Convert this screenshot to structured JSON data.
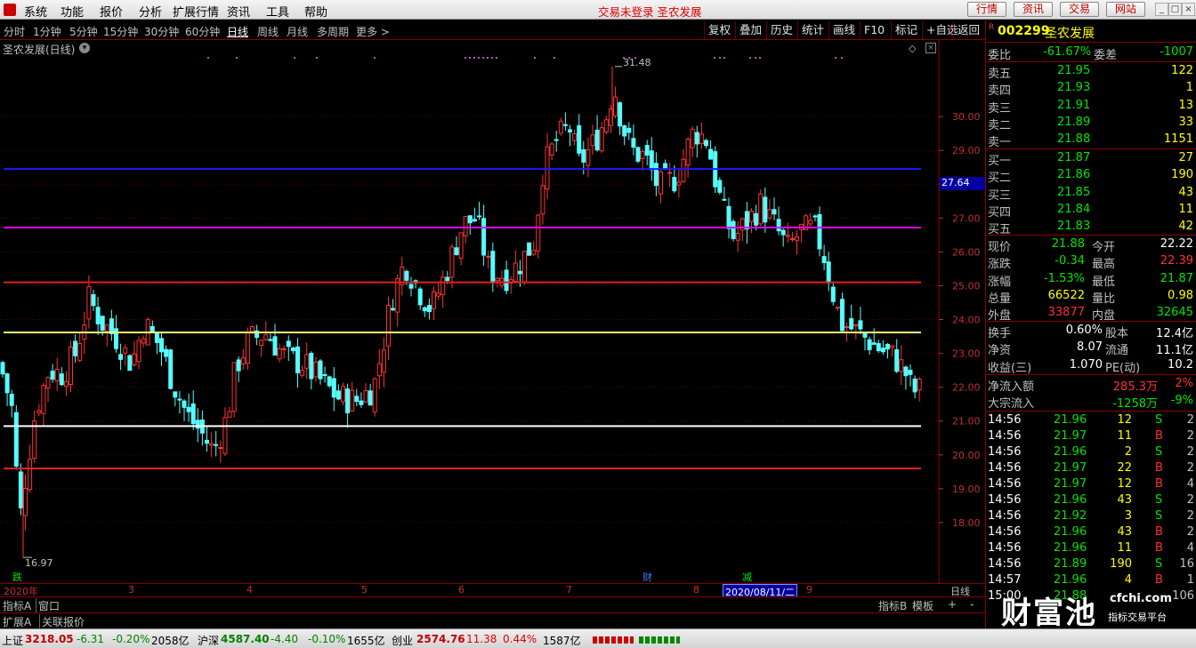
{
  "menu": {
    "items": [
      "系统",
      "功能",
      "报价",
      "分析",
      "扩展行情",
      "资讯",
      "工具",
      "帮助"
    ],
    "title": "交易未登录  圣农发展",
    "buttons": [
      "行情",
      "资讯",
      "交易",
      "网站"
    ]
  },
  "toolbar": {
    "periods": [
      "分时",
      "1分钟",
      "5分钟",
      "15分钟",
      "30分钟",
      "60分钟",
      "日线",
      "周线",
      "月线",
      "多周期",
      "更多 >"
    ],
    "active": "日线",
    "right": [
      "复权",
      "叠加",
      "历史",
      "统计",
      "画线",
      "F10",
      "标记",
      "+自选",
      "返回"
    ]
  },
  "chart": {
    "title": "圣农发展(日线)",
    "high_label": "31.48",
    "low_label": "16.97",
    "cursor_price": "27.64",
    "yticks": [
      "30.00",
      "29.00",
      "28.00",
      "27.00",
      "26.00",
      "25.00",
      "24.00",
      "23.00",
      "22.00",
      "21.00",
      "20.00",
      "19.00",
      "18.00"
    ],
    "markers": [
      "跌",
      "财",
      "减"
    ],
    "xlabels": [
      "2020年",
      "3",
      "4",
      "5",
      "6",
      "7",
      "8",
      "9"
    ],
    "date_tip": "2020/08/11/二",
    "period": "日线"
  },
  "chart_data": {
    "type": "candlestick",
    "symbol": "002299 圣农发展",
    "ylim": [
      16.5,
      32
    ],
    "high": 31.48,
    "low": 16.97,
    "hlines": [
      {
        "price": 28.45,
        "color": "#1a1aff"
      },
      {
        "price": 26.72,
        "color": "#e000e0"
      },
      {
        "price": 25.1,
        "color": "#e02020"
      },
      {
        "price": 23.62,
        "color": "#ffff80"
      },
      {
        "price": 20.85,
        "color": "#ffffff"
      },
      {
        "price": 19.6,
        "color": "#e02020"
      }
    ]
  },
  "quote": {
    "code": "002299",
    "name": "圣农发展",
    "webi_label": "委比",
    "webi": "-61.67%",
    "weicha_label": "委差",
    "weicha": "-1007",
    "sell": [
      {
        "label": "卖五",
        "price": "21.95",
        "vol": "122"
      },
      {
        "label": "卖四",
        "price": "21.93",
        "vol": "1"
      },
      {
        "label": "卖三",
        "price": "21.91",
        "vol": "13"
      },
      {
        "label": "卖二",
        "price": "21.89",
        "vol": "33"
      },
      {
        "label": "卖一",
        "price": "21.88",
        "vol": "1151"
      }
    ],
    "buy": [
      {
        "label": "买一",
        "price": "21.87",
        "vol": "27"
      },
      {
        "label": "买二",
        "price": "21.86",
        "vol": "190"
      },
      {
        "label": "买三",
        "price": "21.85",
        "vol": "43"
      },
      {
        "label": "买四",
        "price": "21.84",
        "vol": "11"
      },
      {
        "label": "买五",
        "price": "21.83",
        "vol": "42"
      }
    ],
    "stats": [
      {
        "l1": "现价",
        "v1": "21.88",
        "c1": "grn",
        "l2": "今开",
        "v2": "22.22",
        "c2": "wht"
      },
      {
        "l1": "涨跌",
        "v1": "-0.34",
        "c1": "grn",
        "l2": "最高",
        "v2": "22.39",
        "c2": "red"
      },
      {
        "l1": "涨幅",
        "v1": "-1.53%",
        "c1": "grn",
        "l2": "最低",
        "v2": "21.87",
        "c2": "grn"
      },
      {
        "l1": "总量",
        "v1": "66522",
        "c1": "yel",
        "l2": "量比",
        "v2": "0.98",
        "c2": "yel"
      },
      {
        "l1": "外盘",
        "v1": "33877",
        "c1": "red",
        "l2": "内盘",
        "v2": "32645",
        "c2": "grn"
      }
    ],
    "stats2": [
      {
        "l1": "换手",
        "v1": "0.60%",
        "l2": "股本",
        "v2": "12.4亿"
      },
      {
        "l1": "净资",
        "v1": "8.07",
        "l2": "流通",
        "v2": "11.1亿"
      },
      {
        "l1": "收益(三)",
        "v1": "1.070",
        "l2": "PE(动)",
        "v2": "10.2"
      }
    ],
    "flow": [
      {
        "label": "净流入额",
        "v": "285.3万",
        "p": "2%",
        "c": "red"
      },
      {
        "label": "大宗流入",
        "v": "-1258万",
        "p": "-9%",
        "c": "grn"
      }
    ],
    "ticks": [
      {
        "t": "14:56",
        "p": "21.96",
        "v": "12",
        "s": "S",
        "n": "2"
      },
      {
        "t": "14:56",
        "p": "21.97",
        "v": "11",
        "s": "B",
        "n": "2"
      },
      {
        "t": "14:56",
        "p": "21.96",
        "v": "2",
        "s": "S",
        "n": "2"
      },
      {
        "t": "14:56",
        "p": "21.97",
        "v": "22",
        "s": "B",
        "n": "2"
      },
      {
        "t": "14:56",
        "p": "21.97",
        "v": "12",
        "s": "B",
        "n": "4"
      },
      {
        "t": "14:56",
        "p": "21.96",
        "v": "43",
        "s": "S",
        "n": "2"
      },
      {
        "t": "14:56",
        "p": "21.92",
        "v": "3",
        "s": "S",
        "n": "2"
      },
      {
        "t": "14:56",
        "p": "21.96",
        "v": "43",
        "s": "B",
        "n": "2"
      },
      {
        "t": "14:56",
        "p": "21.96",
        "v": "11",
        "s": "B",
        "n": "4"
      },
      {
        "t": "14:56",
        "p": "21.89",
        "v": "190",
        "s": "S",
        "n": "16"
      },
      {
        "t": "14:57",
        "p": "21.96",
        "v": "4",
        "s": "B",
        "n": "1"
      },
      {
        "t": "15:00",
        "p": "21.88",
        "v": "",
        "s": "",
        "n": "106"
      }
    ]
  },
  "bottom": {
    "tabs1": [
      "指标A",
      "窗口"
    ],
    "tabs1r": [
      "指标B",
      "模板",
      "+",
      "-"
    ],
    "tabs2": [
      "扩展A",
      "关联报价"
    ]
  },
  "status": {
    "items": [
      {
        "n": "上证",
        "v": "3218.05",
        "c": "-6.31",
        "p": "-0.20%",
        "a": "2058亿"
      },
      {
        "n": "沪深",
        "v": "4587.40",
        "c": "-4.40",
        "p": "-0.10%",
        "a": "1655亿"
      },
      {
        "n": "创业",
        "v": "2574.76",
        "c": "11.38",
        "p": "0.44%",
        "a": "1587亿"
      }
    ]
  },
  "watermark": {
    "text": "财富池",
    "url": "cfchi.com",
    "sub": "指标交易平台"
  }
}
